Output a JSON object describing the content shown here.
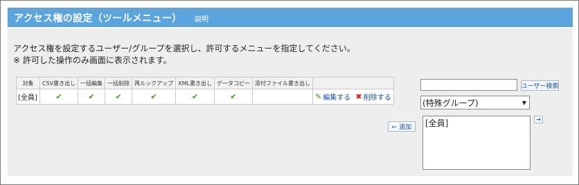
{
  "header": {
    "title": "アクセス権の設定（ツールメニュー）",
    "help_label": "説明"
  },
  "description": {
    "line1": "アクセス権を設定するユーザー/グループを選択し、許可するメニューを指定してください。",
    "line2": "※ 許可した操作のみ画面に表示されます。"
  },
  "table": {
    "columns": [
      "対象",
      "CSV書き出し",
      "一括編集",
      "一括削除",
      "再ルックアップ",
      "XML書き出し",
      "データコピー",
      "添付ファイル書き出し",
      ""
    ],
    "rows": [
      {
        "target": "[全員]",
        "checks": [
          true,
          true,
          true,
          true,
          true,
          true,
          false
        ],
        "edit_label": "編集する",
        "delete_label": "削除する"
      }
    ],
    "check_glyph": "✔"
  },
  "add_button": {
    "label": "← 追加"
  },
  "search": {
    "value": "",
    "button_label": "ユーザー検索"
  },
  "group_select": {
    "selected": "(特殊グループ)"
  },
  "member_list": {
    "items": [
      "[全員]"
    ]
  },
  "move_button": {
    "icon": "arrow-right-icon",
    "glyph": "⇥"
  },
  "colors": {
    "header": "#5ba4dd",
    "panel": "#eeeeee",
    "check": "#3b9a1e",
    "delete": "#d11c1c",
    "link": "#1a4fa0"
  }
}
